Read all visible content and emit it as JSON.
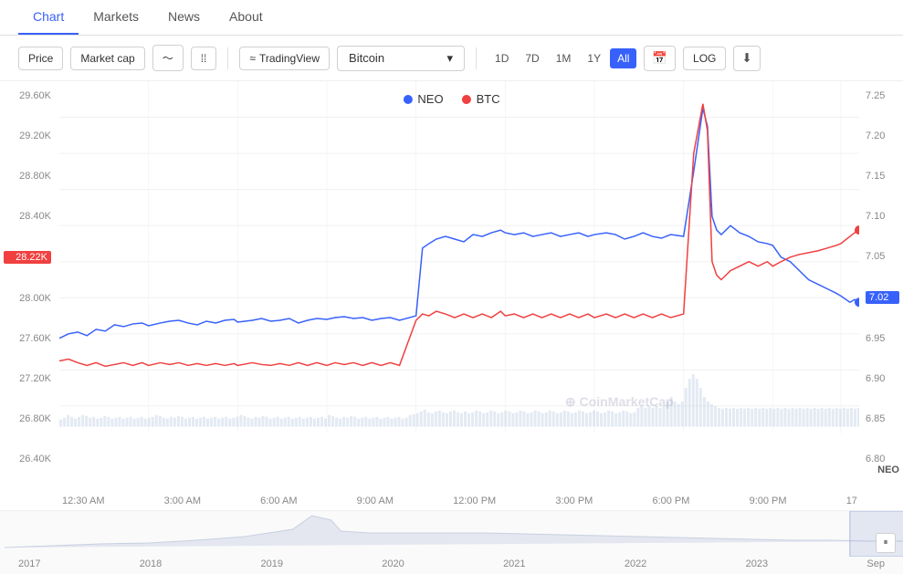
{
  "nav": {
    "items": [
      {
        "label": "Chart",
        "active": true
      },
      {
        "label": "Markets",
        "active": false
      },
      {
        "label": "News",
        "active": false
      },
      {
        "label": "About",
        "active": false
      }
    ]
  },
  "toolbar": {
    "price_label": "Price",
    "marketcap_label": "Market cap",
    "tradingview_label": "TradingView",
    "coin_label": "Bitcoin",
    "timeframes": [
      "1D",
      "7D",
      "1M",
      "1Y",
      "All"
    ],
    "active_timeframe": "All",
    "log_label": "LOG",
    "icons": {
      "line_icon": "〜",
      "candle_icon": "⁞⁞",
      "calendar_icon": "📅",
      "download_icon": "⬇"
    }
  },
  "chart": {
    "legend": [
      {
        "label": "NEO",
        "color": "#3861fb"
      },
      {
        "label": "BTC",
        "color": "#f04040"
      }
    ],
    "y_axis_left": [
      "29.60K",
      "29.20K",
      "28.80K",
      "28.40K",
      "28.00K",
      "27.60K",
      "27.20K",
      "26.80K",
      "26.40K"
    ],
    "y_axis_left_highlighted": "28.22K",
    "y_axis_right": [
      "7.25",
      "7.20",
      "7.15",
      "7.10",
      "7.05",
      "7.00",
      "6.95",
      "6.90",
      "6.85",
      "6.80"
    ],
    "y_axis_right_highlighted": "7.02",
    "x_axis_labels": [
      "12:30 AM",
      "3:00 AM",
      "6:00 AM",
      "9:00 AM",
      "12:00 PM",
      "3:00 PM",
      "6:00 PM",
      "9:00 PM",
      "17"
    ],
    "neo_label": "NEO",
    "watermark": "⊕ CoinMarketCap"
  },
  "mini_chart": {
    "timeline_labels": [
      "2017",
      "2018",
      "2019",
      "2020",
      "2021",
      "2022",
      "2023",
      "Sep"
    ]
  }
}
